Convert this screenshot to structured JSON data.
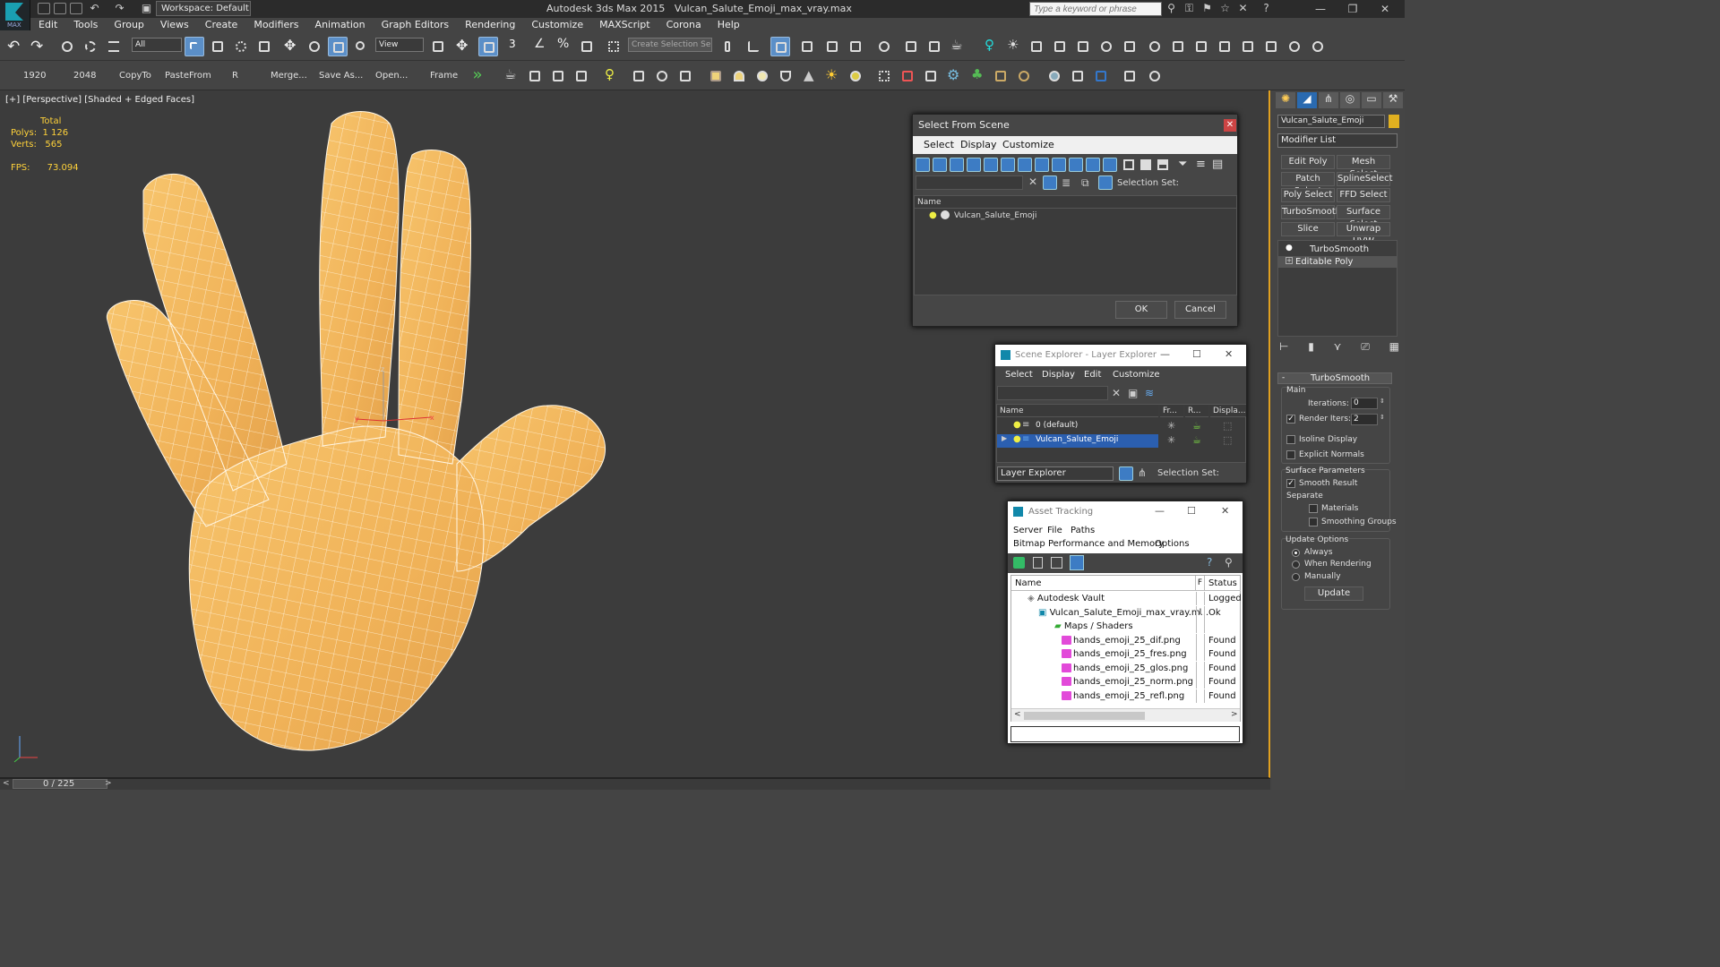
{
  "app": {
    "title": "Autodesk 3ds Max 2015",
    "filename": "Vulcan_Salute_Emoji_max_vray.max",
    "workspace": "Workspace: Default",
    "search_placeholder": "Type a keyword or phrase",
    "logo_text": "MAX"
  },
  "menu": [
    "Edit",
    "Tools",
    "Group",
    "Views",
    "Create",
    "Modifiers",
    "Animation",
    "Graph Editors",
    "Rendering",
    "Customize",
    "MAXScript",
    "Corona",
    "Help"
  ],
  "toolbar1": {
    "filter_value": "All",
    "view_value": "View",
    "selection_set_placeholder": "Create Selection Se"
  },
  "toolbar2": {
    "labels": [
      "1920",
      "2048",
      "CopyTo",
      "PasteFrom",
      "R",
      "Merge...",
      "Save As...",
      "Open...",
      "Frame"
    ]
  },
  "viewport": {
    "label": "[+] [Perspective] [Shaded + Edged Faces]",
    "stats_header": "Total",
    "polys_label": "Polys:",
    "polys_value": "1 126",
    "verts_label": "Verts:",
    "verts_value": "565",
    "fps_label": "FPS:",
    "fps_value": "73.094",
    "gizmo_x": "x",
    "gizmo_y": "y",
    "gizmo_z": "z"
  },
  "timeline": {
    "frame": "0 / 225"
  },
  "select_from_scene": {
    "title": "Select From Scene",
    "menus": [
      "Select",
      "Display",
      "Customize"
    ],
    "selection_set_label": "Selection Set:",
    "column_name": "Name",
    "item": "Vulcan_Salute_Emoji",
    "ok": "OK",
    "cancel": "Cancel"
  },
  "scene_explorer": {
    "title": "Scene Explorer - Layer Explorer",
    "menus": [
      "Select",
      "Display",
      "Edit",
      "Customize"
    ],
    "columns": [
      "Name",
      "Fr...",
      "R...",
      "Displa..."
    ],
    "rows": [
      "0 (default)",
      "Vulcan_Salute_Emoji"
    ],
    "footer_dropdown": "Layer Explorer",
    "selection_set_label": "Selection Set:"
  },
  "asset_tracking": {
    "title": "Asset Tracking",
    "menus": [
      "Server",
      "File",
      "Paths"
    ],
    "menus2": [
      "Bitmap Performance and Memory",
      "Options"
    ],
    "columns": [
      "Name",
      "F",
      "Status"
    ],
    "rows": [
      {
        "name": "Autodesk Vault",
        "status": "Logged",
        "indent": 1
      },
      {
        "name": "Vulcan_Salute_Emoji_max_vray.m...",
        "status": "Ok",
        "indent": 2,
        "flag": "I"
      },
      {
        "name": "Maps / Shaders",
        "status": "",
        "indent": 3
      },
      {
        "name": "hands_emoji_25_dif.png",
        "status": "Found",
        "indent": 4
      },
      {
        "name": "hands_emoji_25_fres.png",
        "status": "Found",
        "indent": 4
      },
      {
        "name": "hands_emoji_25_glos.png",
        "status": "Found",
        "indent": 4
      },
      {
        "name": "hands_emoji_25_norm.png",
        "status": "Found",
        "indent": 4
      },
      {
        "name": "hands_emoji_25_refl.png",
        "status": "Found",
        "indent": 4
      }
    ]
  },
  "command_panel": {
    "object_name": "Vulcan_Salute_Emoji",
    "modifier_list": "Modifier List",
    "buttons": [
      "Edit Poly",
      "Mesh Select",
      "Patch Select",
      "SplineSelect",
      "Poly Select",
      "FFD Select",
      "TurboSmooth",
      "Surface Select",
      "Slice",
      "Unwrap UVW"
    ],
    "stack": [
      "TurboSmooth",
      "Editable Poly"
    ],
    "rollout_title": "TurboSmooth",
    "main_label": "Main",
    "iterations_label": "Iterations:",
    "iterations_value": "0",
    "render_iters_label": "Render Iters:",
    "render_iters_value": "2",
    "isoline_display": "Isoline Display",
    "explicit_normals": "Explicit Normals",
    "surface_params": "Surface Parameters",
    "smooth_result": "Smooth Result",
    "separate": "Separate",
    "materials": "Materials",
    "smoothing_groups": "Smoothing Groups",
    "update_options": "Update Options",
    "always": "Always",
    "when_rendering": "When Rendering",
    "manually": "Manually",
    "update": "Update",
    "object_color": "#e0b020"
  }
}
